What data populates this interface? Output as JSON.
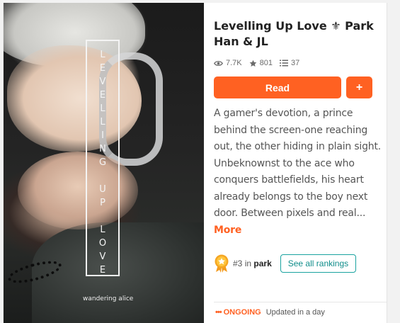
{
  "cover": {
    "frame_letters": [
      "L",
      "E",
      "V",
      "E",
      "L",
      "L",
      "I",
      "N",
      "G",
      "",
      "U",
      "P",
      "",
      "L",
      "O",
      "V",
      "E"
    ],
    "author_mark": "wandering alice"
  },
  "story": {
    "title": "Levelling Up Love ⚜ Park Han & JL",
    "stats": {
      "reads": "7.7K",
      "votes": "801",
      "parts": "37"
    },
    "read_label": "Read",
    "add_label": "+",
    "description": "A gamer's devotion, a prince behind the screen-one reaching out, the other hiding in plain sight. Unbeknownst to the ace who conquers battlefields, his heart already belongs to the boy next door. Between pixels and real...",
    "more_label": "More",
    "ranking": {
      "rank": "#3",
      "in_label": "in",
      "tag": "park",
      "see_all_label": "See all rankings"
    },
    "status": {
      "dots": "•••",
      "state": "ONGOING",
      "updated": "Updated in a day"
    }
  },
  "colors": {
    "accent": "#ff6122",
    "teal": "#1aa3a0"
  },
  "icons": [
    "eye-icon",
    "star-icon",
    "list-icon",
    "rank-badge-icon"
  ]
}
